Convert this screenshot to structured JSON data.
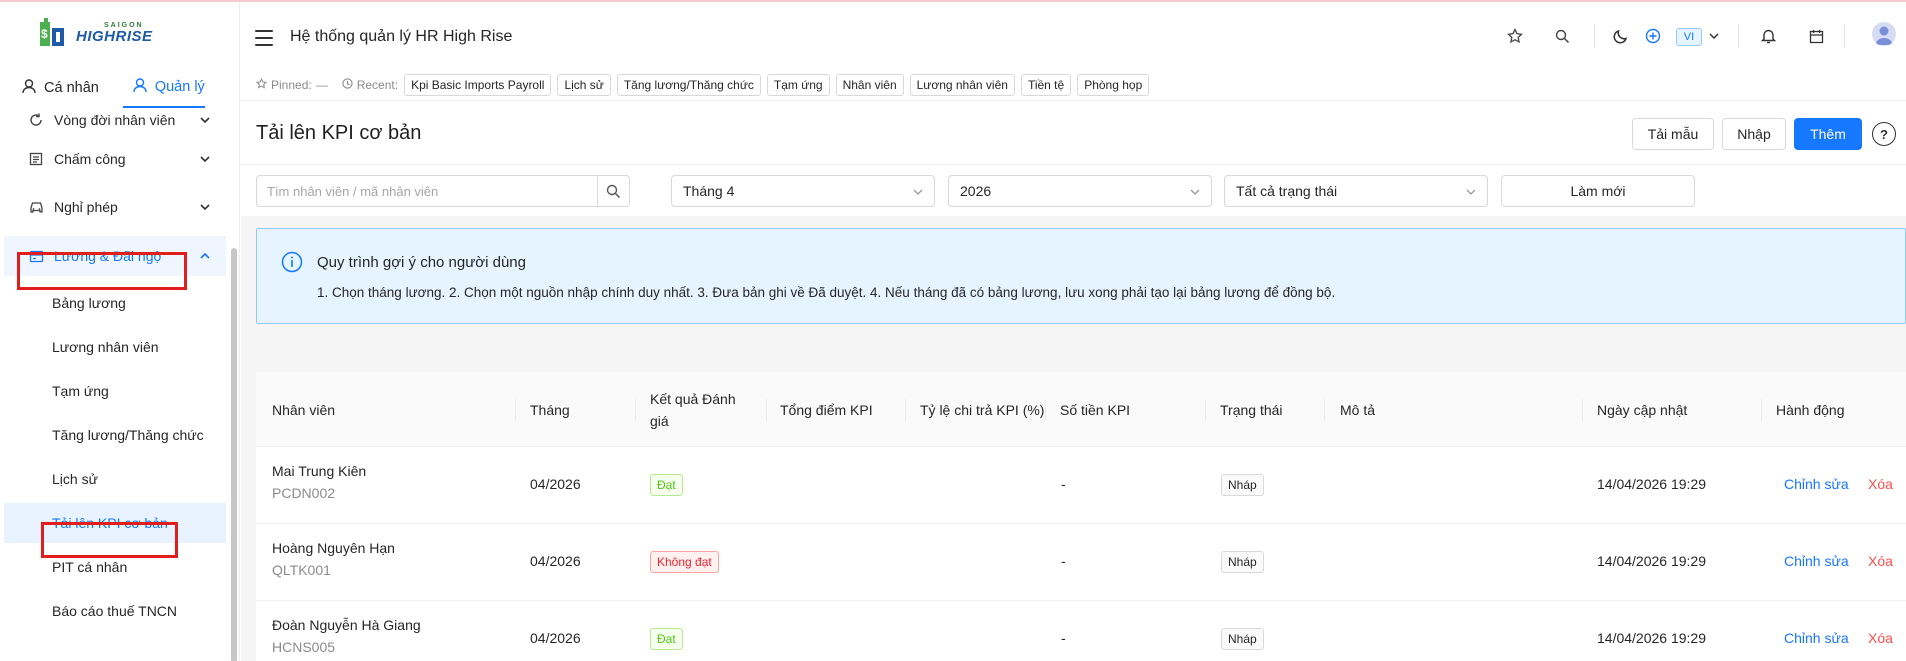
{
  "app": {
    "title": "Hệ thống quản lý HR High Rise",
    "logo_small": "SAIGON",
    "logo_big": "HIGHRISE",
    "lang": "VI"
  },
  "sidebar": {
    "modes": [
      {
        "label": "Cá nhân",
        "icon": "user-icon"
      },
      {
        "label": "Quản lý",
        "icon": "user-icon"
      }
    ],
    "items": [
      {
        "label": "Vòng đời nhân viên",
        "icon": "cycle-icon"
      },
      {
        "label": "Chấm công",
        "icon": "calendar-list-icon"
      },
      {
        "label": "Nghỉ phép",
        "icon": "car-icon"
      },
      {
        "label": "Lương & Đãi ngộ",
        "icon": "wallet-icon"
      }
    ],
    "subitems": [
      "Bảng lương",
      "Lương nhân viên",
      "Tạm ứng",
      "Tăng lương/Thăng chức",
      "Lịch sử",
      "Tải lên KPI cơ bản",
      "PIT cá nhân",
      "Báo cáo thuế TNCN"
    ]
  },
  "recent": {
    "pinned_label": "Pinned:",
    "pinned_value": "—",
    "recent_label": "Recent:",
    "chips": [
      "Kpi Basic Imports Payroll",
      "Lịch sử",
      "Tăng lương/Thăng chức",
      "Tạm ứng",
      "Nhân viên",
      "Lương nhân viên",
      "Tiền tệ",
      "Phòng họp"
    ]
  },
  "page": {
    "title": "Tải lên KPI cơ bản",
    "btn_template": "Tải mẫu",
    "btn_import": "Nhập",
    "btn_add": "Thêm",
    "help": "?"
  },
  "filters": {
    "search_placeholder": "Tìm nhân viên / mã nhân viên",
    "month": "Tháng 4",
    "year": "2026",
    "status": "Tất cả trạng thái",
    "refresh": "Làm mới"
  },
  "info": {
    "title": "Quy trình gợi ý cho người dùng",
    "desc": "1. Chọn tháng lương. 2. Chọn một nguồn nhập chính duy nhất. 3. Đưa bản ghi về Đã duyệt. 4. Nếu tháng đã có bảng lương, lưu xong phải tạo lại bảng lương để đồng bộ."
  },
  "table": {
    "columns": [
      "Nhân viên",
      "Tháng",
      "Kết quả Đánh giá",
      "Tổng điểm KPI",
      "Tỷ lệ chi trả KPI (%)",
      "Số tiền KPI",
      "Trạng thái",
      "Mô tả",
      "Ngày cập nhật",
      "Hành động"
    ],
    "rows": [
      {
        "name": "Mai Trung Kiên",
        "code": "PCDN002",
        "month": "04/2026",
        "result": "Đạt",
        "result_color": "#52c41a",
        "amount": "-",
        "status": "Nháp",
        "updated": "14/04/2026 19:29",
        "edit": "Chỉnh sửa",
        "delete": "Xóa"
      },
      {
        "name": "Hoàng Nguyên Hạn",
        "code": "QLTK001",
        "month": "04/2026",
        "result": "Không đạt",
        "result_color": "#f5222d",
        "amount": "-",
        "status": "Nháp",
        "updated": "14/04/2026 19:29",
        "edit": "Chỉnh sửa",
        "delete": "Xóa"
      },
      {
        "name": "Đoàn Nguyễn Hà Giang",
        "code": "HCNS005",
        "month": "04/2026",
        "result": "Đạt",
        "result_color": "#52c41a",
        "amount": "-",
        "status": "Nháp",
        "updated": "14/04/2026 19:29",
        "edit": "Chỉnh sửa",
        "delete": "Xóa"
      }
    ]
  },
  "colors": {
    "accent": "#1677ff",
    "highlight_box": "#e01e1e",
    "info_bg": "#e6f4ff"
  }
}
